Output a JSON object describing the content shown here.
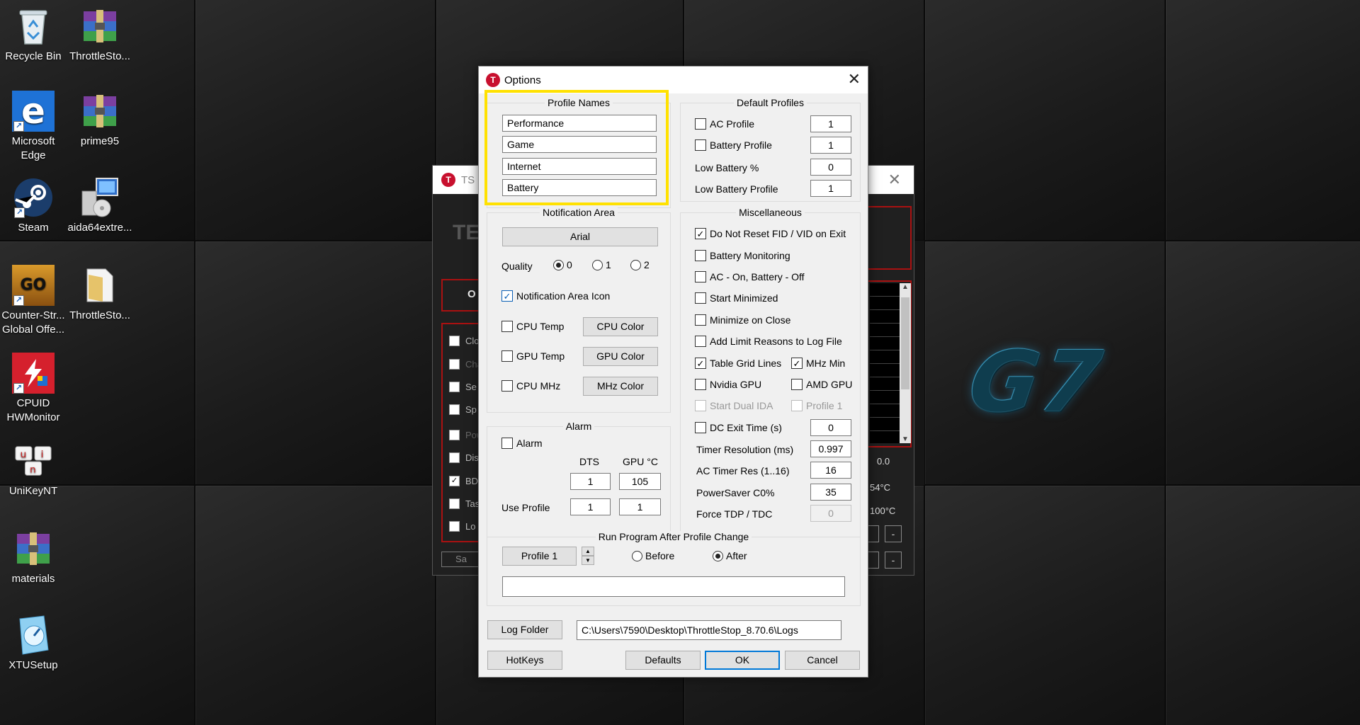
{
  "desktop": {
    "icons": [
      {
        "label": "Recycle Bin",
        "icon": "recycle-bin-icon"
      },
      {
        "label": "ThrottleSto...",
        "icon": "winrar-archive-icon"
      },
      {
        "label": "Microsoft Edge",
        "icon": "edge-icon"
      },
      {
        "label": "prime95",
        "icon": "winrar-archive-icon"
      },
      {
        "label": "Steam",
        "icon": "steam-icon"
      },
      {
        "label": "aida64extre...",
        "icon": "installer-icon"
      },
      {
        "label": "Counter-Str... Global Offe...",
        "icon": "csgo-icon"
      },
      {
        "label": "ThrottleSto...",
        "icon": "folder-icon"
      },
      {
        "label": "CPUID HWMonitor",
        "icon": "hwmonitor-icon"
      },
      {
        "label": "UniKeyNT",
        "icon": "unikey-icon"
      },
      {
        "label": "materials",
        "icon": "winrar-archive-icon"
      },
      {
        "label": "XTUSetup",
        "icon": "xtu-gauge-icon"
      }
    ],
    "logo_text": "G7"
  },
  "ts_window": {
    "title": "TS 8",
    "heading_fragment": "TE",
    "radio_fragment": "O",
    "rows": [
      "Clo",
      "Cha",
      "Se",
      "Sp",
      "Pow",
      "Dis",
      "BD",
      "Tas",
      "Lo"
    ],
    "save_fragment": "Sa",
    "value_00": "0.0",
    "temp1": "54°C",
    "temp2": "100°C",
    "minus": "-"
  },
  "dialog": {
    "title": "Options",
    "profile_names": {
      "title": "Profile Names",
      "names": [
        "Performance",
        "Game",
        "Internet",
        "Battery"
      ]
    },
    "default_profiles": {
      "title": "Default Profiles",
      "ac_profile_label": "AC Profile",
      "ac_profile_value": "1",
      "battery_profile_label": "Battery Profile",
      "battery_profile_value": "1",
      "low_battery_pct_label": "Low Battery %",
      "low_battery_pct_value": "0",
      "low_battery_profile_label": "Low Battery Profile",
      "low_battery_profile_value": "1"
    },
    "notification_area": {
      "title": "Notification Area",
      "font_button": "Arial",
      "quality_label": "Quality",
      "quality_options": [
        "0",
        "1",
        "2"
      ],
      "quality_selected": "0",
      "icon_label": "Notification Area Icon",
      "cpu_temp_label": "CPU Temp",
      "cpu_color_button": "CPU Color",
      "gpu_temp_label": "GPU Temp",
      "gpu_color_button": "GPU Color",
      "cpu_mhz_label": "CPU MHz",
      "mhz_color_button": "MHz Color"
    },
    "alarm": {
      "title": "Alarm",
      "alarm_label": "Alarm",
      "dts_header": "DTS",
      "gpu_header": "GPU °C",
      "dts_value": "1",
      "gpu_value": "105",
      "use_profile_label": "Use Profile",
      "use_profile_dts": "1",
      "use_profile_gpu": "1"
    },
    "misc": {
      "title": "Miscellaneous",
      "do_not_reset": "Do Not Reset FID / VID on Exit",
      "battery_monitoring": "Battery Monitoring",
      "ac_on_battery_off": "AC - On, Battery - Off",
      "start_minimized": "Start Minimized",
      "minimize_on_close": "Minimize on Close",
      "add_limit_reasons": "Add Limit Reasons to Log File",
      "table_grid_lines": "Table Grid Lines",
      "mhz_min": "MHz Min",
      "nvidia_gpu": "Nvidia GPU",
      "amd_gpu": "AMD GPU",
      "start_dual_ida": "Start Dual IDA",
      "profile_1": "Profile 1",
      "dc_exit_time_label": "DC Exit Time (s)",
      "dc_exit_time_value": "0",
      "timer_resolution_label": "Timer Resolution (ms)",
      "timer_resolution_value": "0.997",
      "ac_timer_res_label": "AC Timer Res (1..16)",
      "ac_timer_res_value": "16",
      "powersaver_label": "PowerSaver C0%",
      "powersaver_value": "35",
      "force_tdp_label": "Force TDP / TDC",
      "force_tdp_value": "0"
    },
    "run_program": {
      "title": "Run Program After Profile Change",
      "profile_button": "Profile 1",
      "before_label": "Before",
      "after_label": "After",
      "selected": "After",
      "program_path": ""
    },
    "log_folder_button": "Log Folder",
    "log_folder_path": "C:\\Users\\7590\\Desktop\\ThrottleStop_8.70.6\\Logs",
    "hotkeys_button": "HotKeys",
    "defaults_button": "Defaults",
    "ok_button": "OK",
    "cancel_button": "Cancel"
  },
  "colors": {
    "highlight": "#ffe100",
    "ts_red": "#c8102e",
    "focus_blue": "#0078d7"
  }
}
